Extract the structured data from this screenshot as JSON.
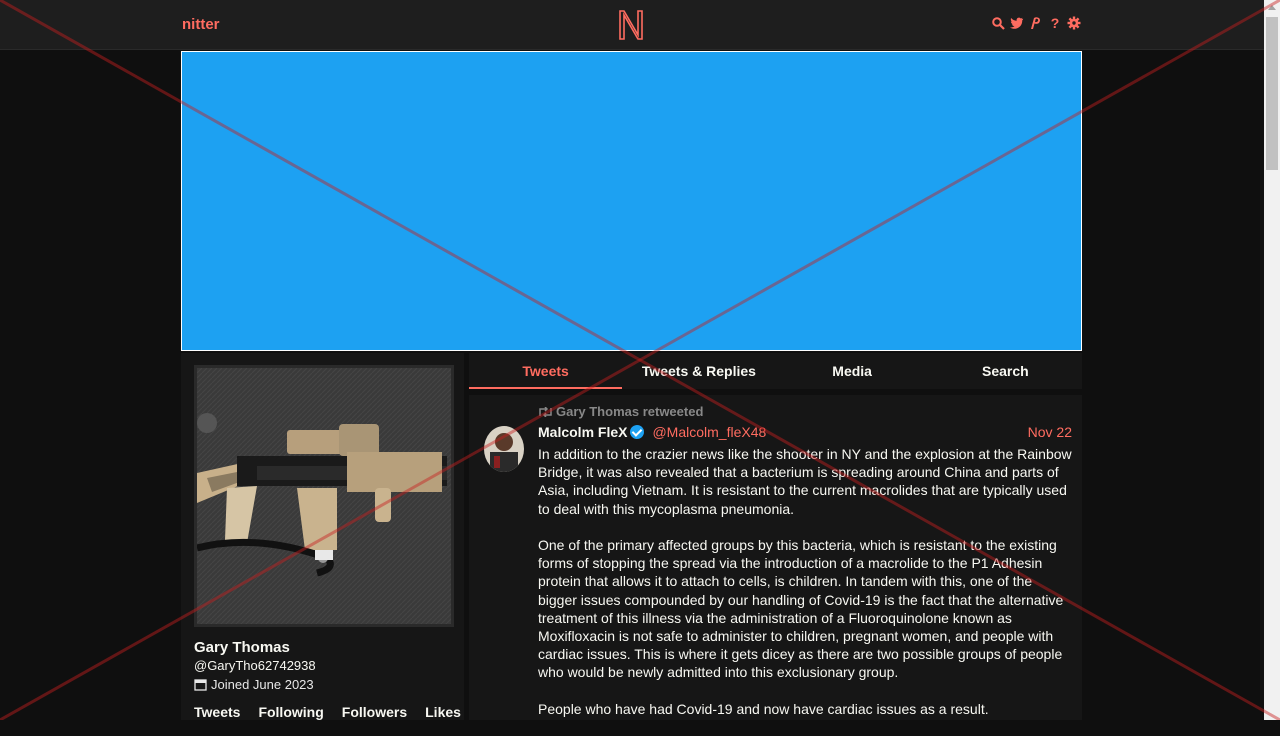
{
  "nav": {
    "brand": "nitter",
    "logo_letter": "N",
    "icons": [
      "search-icon",
      "twitter-icon",
      "rss-icon",
      "help-icon",
      "gear-icon"
    ]
  },
  "profile": {
    "fullname": "Gary Thomas",
    "username": "@GaryTho62742938",
    "joined": "Joined June 2023",
    "stats": [
      "Tweets",
      "Following",
      "Followers",
      "Likes"
    ]
  },
  "tabs": [
    "Tweets",
    "Tweets & Replies",
    "Media",
    "Search"
  ],
  "tweet": {
    "retweet_header": "Gary Thomas retweeted",
    "name": "Malcolm FleX",
    "handle": "@Malcolm_fleX48",
    "date": "Nov 22",
    "paragraphs": [
      "In addition to the crazier news like the shooter in NY and the explosion at the Rainbow Bridge, it was also revealed that a bacterium is spreading around China and parts of Asia, including Vietnam. It is resistant to the current macrolides that are typically used to deal with this mycoplasma pneumonia.",
      "One of the primary affected groups by this bacteria, which is resistant to the existing forms of stopping the spread via the introduction of a macrolide to the P1 Adhesin protein that allows it to attach to cells, is children. In tandem with this, one of the bigger issues compounded by our handling of Covid-19 is the fact that the alternative treatment of this illness via the administration of a Fluoroquinolone known as Moxifloxacin is not safe to administer to children, pregnant women, and people with cardiac issues. This is where it gets dicey as there are two possible groups of people who would be newly admitted into this exclusionary group.",
      "People who have had Covid-19 and now have cardiac issues as a result."
    ]
  },
  "colors": {
    "accent": "#ff6c60",
    "banner": "#1da1f2",
    "background": "#0f0f0f",
    "panel": "#161616",
    "navbar": "#1e1e1e"
  }
}
